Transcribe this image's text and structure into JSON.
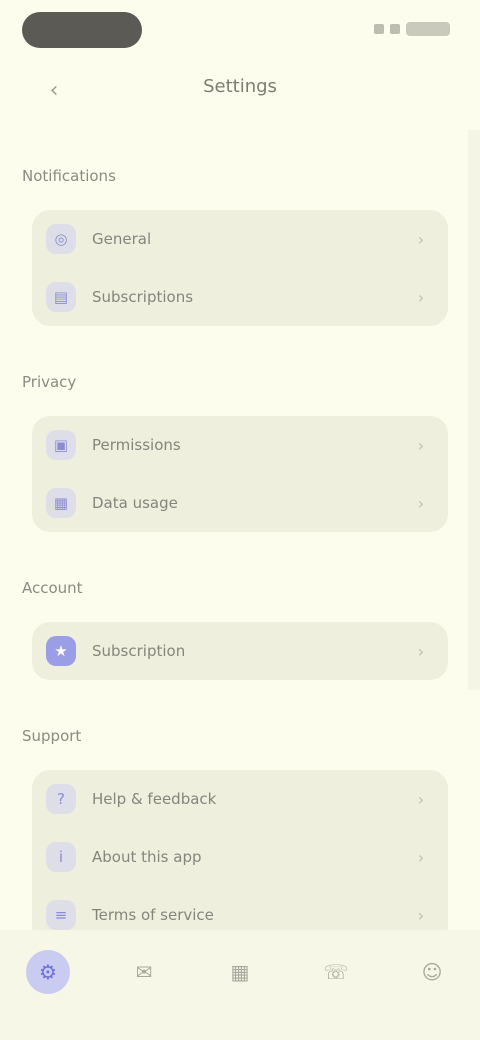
{
  "app_bar": {
    "title": "Settings",
    "back_glyph": "‹"
  },
  "icons": {
    "back": "back-arrow-icon",
    "chevron": "chevron-right-icon"
  },
  "sections": [
    {
      "title": "Notifications",
      "items": [
        {
          "label": "General",
          "icon": "bell-icon",
          "glyph": "◎",
          "filled": false
        },
        {
          "label": "Subscriptions",
          "icon": "list-icon",
          "glyph": "▤",
          "filled": false
        }
      ]
    },
    {
      "title": "Privacy",
      "items": [
        {
          "label": "Permissions",
          "icon": "lock-icon",
          "glyph": "▣",
          "filled": false
        },
        {
          "label": "Data usage",
          "icon": "chart-icon",
          "glyph": "▦",
          "filled": false
        }
      ]
    },
    {
      "title": "Account",
      "items": [
        {
          "label": "Subscription",
          "icon": "star-icon",
          "glyph": "★",
          "filled": true
        }
      ]
    },
    {
      "title": "Support",
      "items": [
        {
          "label": "Help & feedback",
          "icon": "help-icon",
          "glyph": "?",
          "filled": false
        },
        {
          "label": "About this app",
          "icon": "info-icon",
          "glyph": "i",
          "filled": false
        },
        {
          "label": "Terms of service",
          "icon": "document-icon",
          "glyph": "≡",
          "filled": false
        }
      ]
    }
  ],
  "chevron_glyph": "›",
  "bottom_nav": [
    {
      "label": "",
      "icon": "settings-icon",
      "glyph": "⚙",
      "active": true
    },
    {
      "label": "",
      "icon": "chat-icon",
      "glyph": "✉",
      "active": false
    },
    {
      "label": "",
      "icon": "calendar-icon",
      "glyph": "▦",
      "active": false
    },
    {
      "label": "",
      "icon": "phone-icon",
      "glyph": "☏",
      "active": false
    },
    {
      "label": "",
      "icon": "person-icon",
      "glyph": "☺",
      "active": false
    }
  ]
}
